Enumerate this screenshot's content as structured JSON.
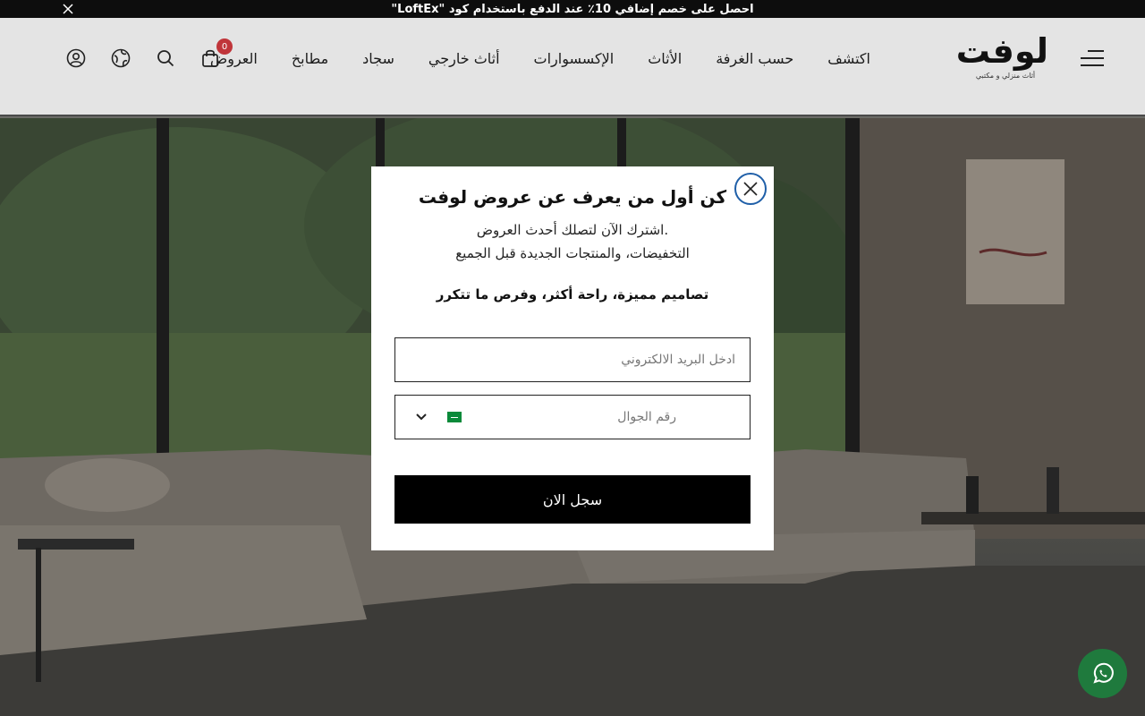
{
  "announcement": {
    "text": "احصل على خصم إضافي 10٪ عند الدفع باستخدام كود \"LoftEx\""
  },
  "header": {
    "logo_text": "لوفت",
    "logo_tagline": "أثاث منزلي و مكتبي",
    "nav": [
      {
        "label": "اكتشف"
      },
      {
        "label": "حسب الغرفة"
      },
      {
        "label": "الأثاث"
      },
      {
        "label": "الإكسسوارات"
      },
      {
        "label": "أثاث خارجي"
      },
      {
        "label": "سجاد"
      },
      {
        "label": "مطابخ"
      },
      {
        "label": "العروض"
      }
    ],
    "cart_count": "0"
  },
  "modal": {
    "title": "كن أول من يعرف عن عروض لوفت",
    "subtitle_line1": ".اشترك الآن لتصلك أحدث العروض",
    "subtitle_line2": "التخفيضات، والمنتجات الجديدة قبل الجميع",
    "tagline": "تصاميم مميزة، راحة أكثر، وفرص ما تتكرر",
    "email_placeholder": "ادخل البريد الالكتروني",
    "phone_placeholder": "رقم الجوال",
    "submit_label": "سجل الان"
  },
  "colors": {
    "accent_close": "#1f5fa8",
    "whatsapp": "#1f7a3d",
    "badge": "#c0353a",
    "flag": "#0a8a3a"
  }
}
